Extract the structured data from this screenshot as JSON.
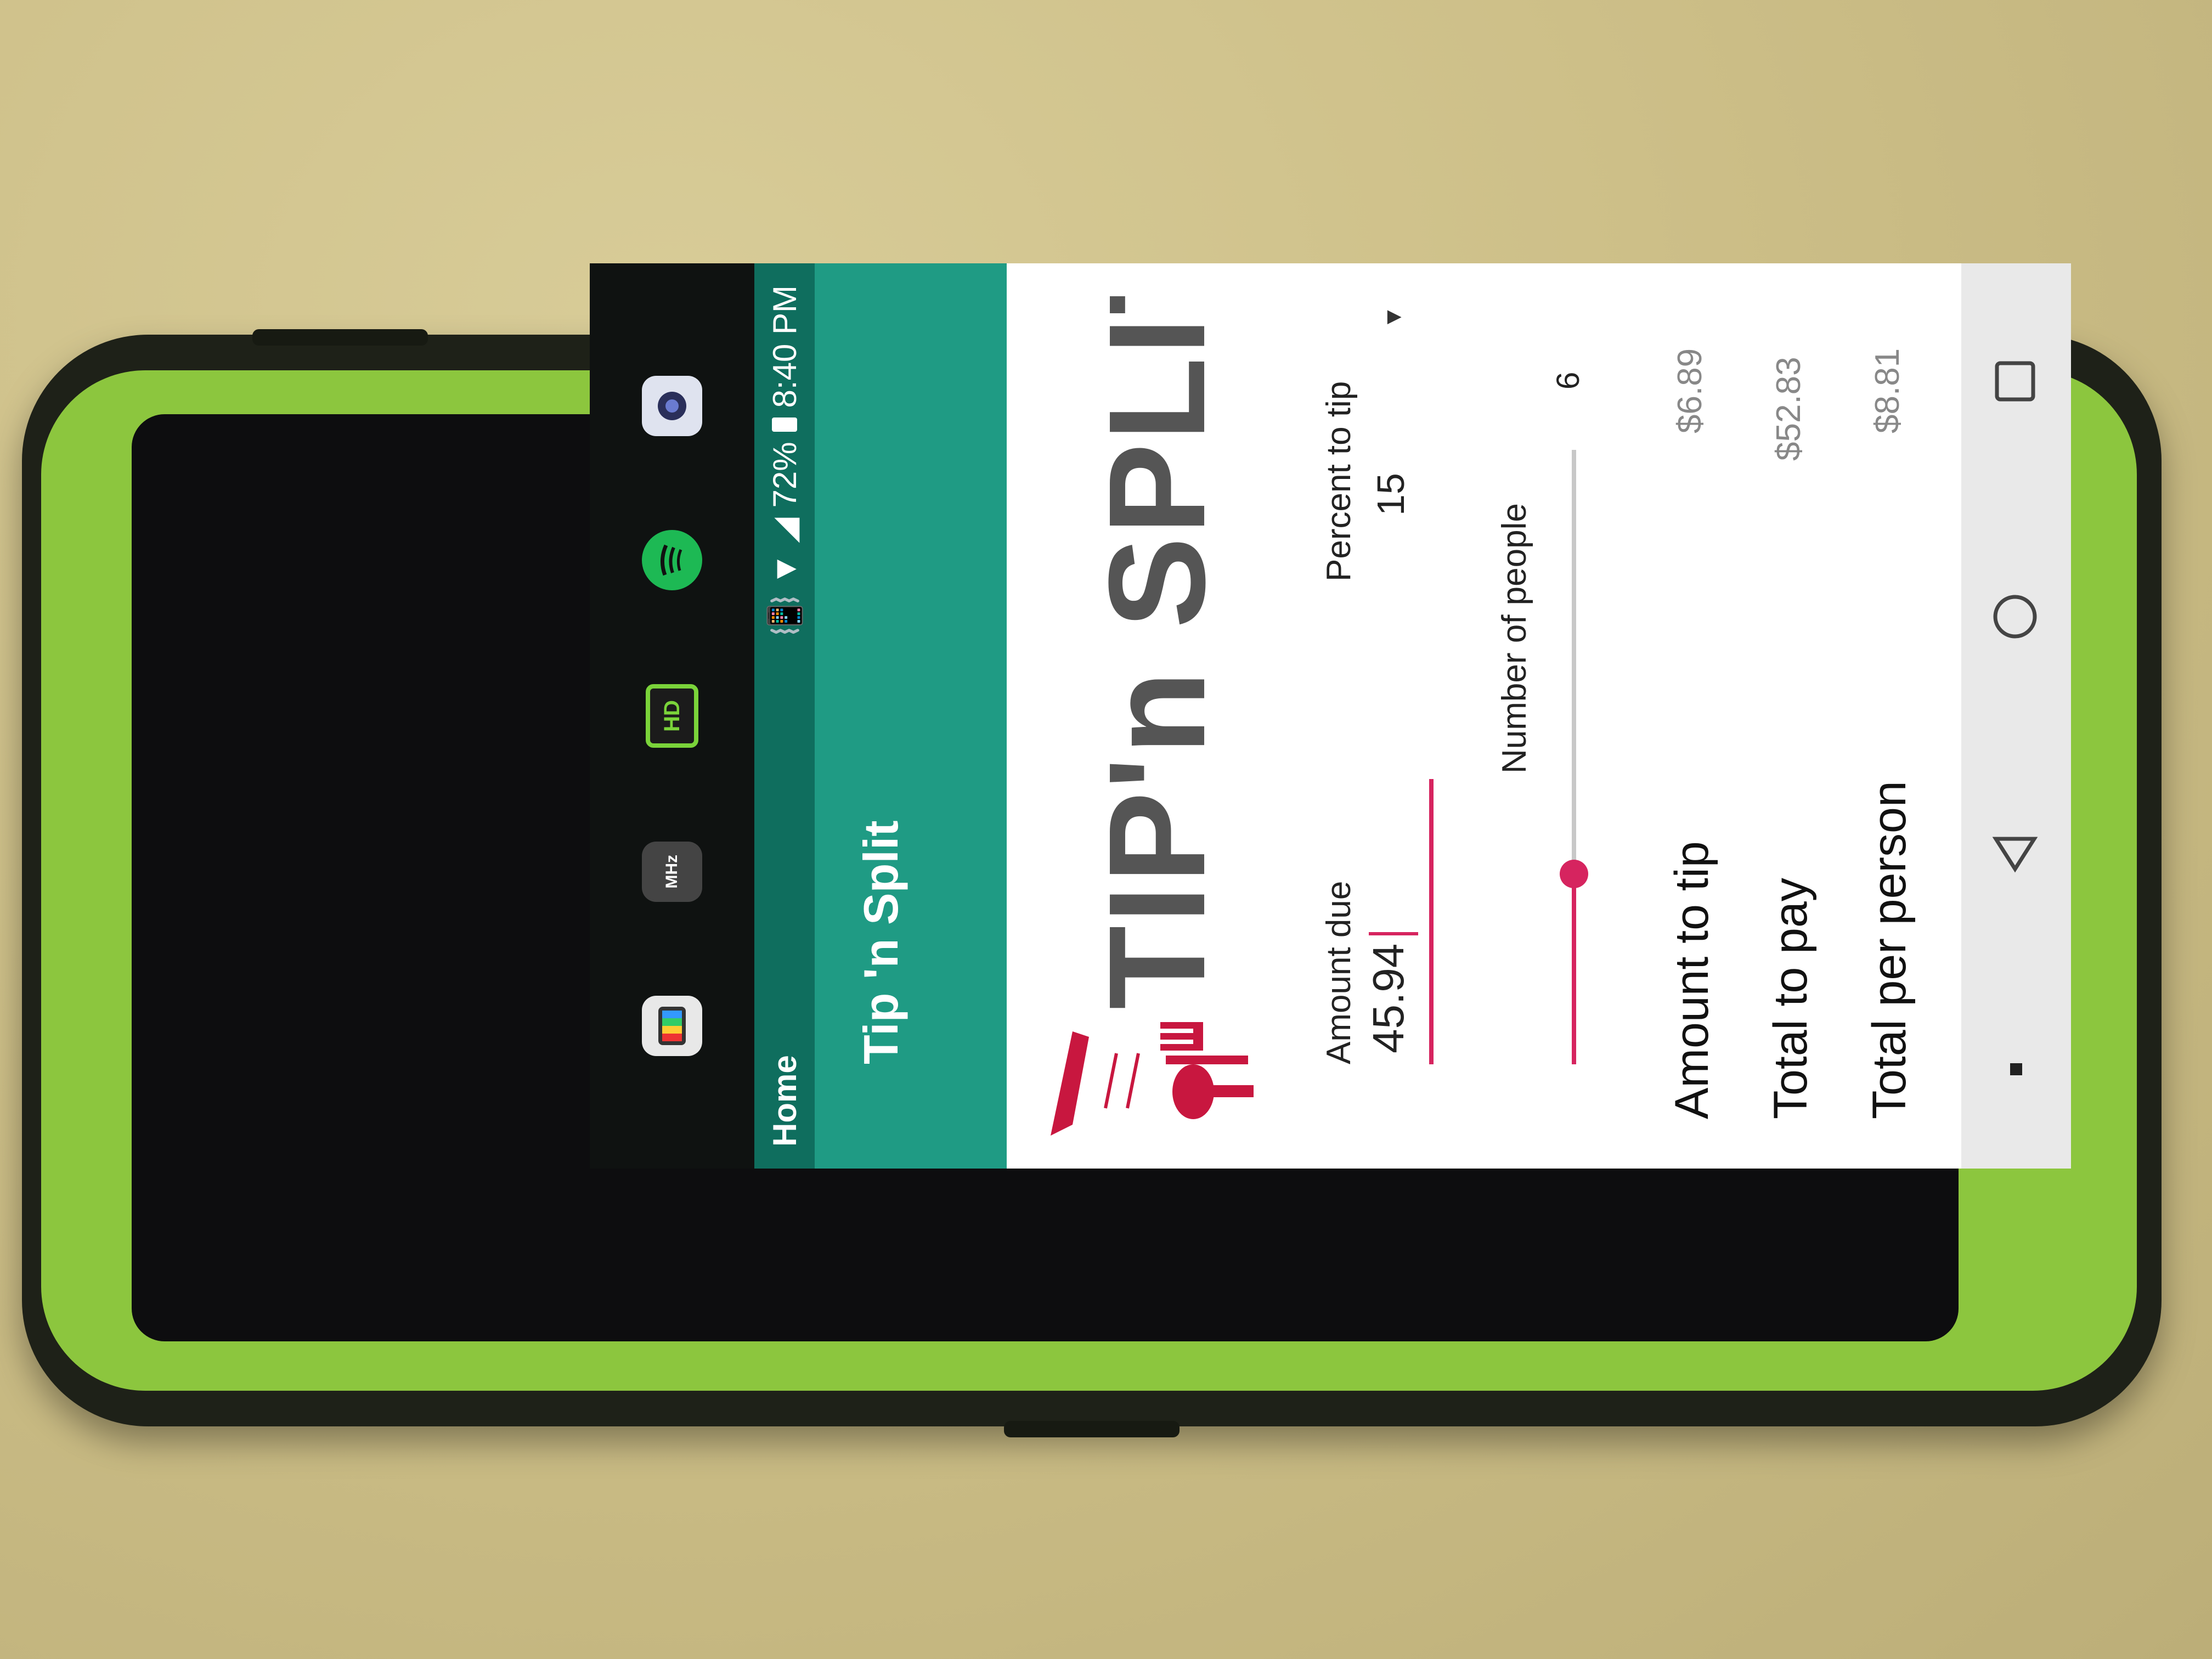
{
  "status_bar": {
    "carrier_label": "Home",
    "battery": "72%",
    "time": "8:40 PM"
  },
  "second_screen": {
    "apps": [
      {
        "icon": "tv-app-icon",
        "label": ""
      },
      {
        "icon": "mhz-radio-icon",
        "label": "MHz"
      },
      {
        "icon": "hd-icon",
        "label": "HD"
      },
      {
        "icon": "spotify-icon",
        "label": ""
      },
      {
        "icon": "camera-icon",
        "label": ""
      }
    ]
  },
  "toolbar": {
    "title": "Tip 'n Split"
  },
  "logo": {
    "text": "TIP'n SPLIT"
  },
  "form": {
    "amount_label": "Amount due",
    "amount_value": "45.94",
    "percent_label": "Percent to tip",
    "percent_value": "15",
    "people_label": "Number of people",
    "people_value": "6",
    "people_slider_fraction": 0.31
  },
  "results": {
    "tip_label": "Amount to tip",
    "tip_value": "$6.89",
    "total_label": "Total to pay",
    "total_value": "$52.83",
    "per_person_label": "Total per person",
    "per_person_value": "$8.81"
  },
  "colors": {
    "primary": "#1f9b84",
    "primary_dark": "#0f6e5e",
    "accent": "#d6245f",
    "case_green": "#8cc63e"
  }
}
